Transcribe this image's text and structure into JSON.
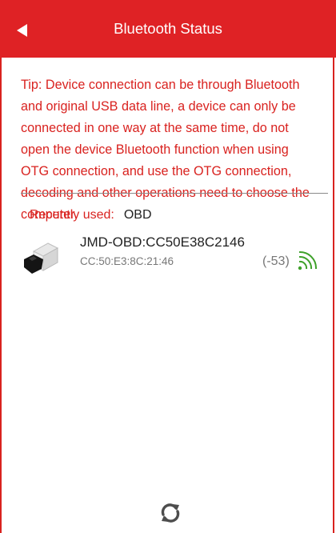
{
  "header": {
    "title": "Bluetooth Status",
    "back_icon": "back-arrow-icon"
  },
  "tip": {
    "text": "Tip: Device connection can be through Bluetooth and original USB data line, a device can only be connected in one way at the same time, do not open the device Bluetooth function when using OTG connection, and use the OTG connection, decoding and other operations need to choose the computer."
  },
  "recent": {
    "label": "Recently used:",
    "value": "OBD"
  },
  "devices": [
    {
      "name": "JMD-OBD:CC50E38C2146",
      "mac": "CC:50:E3:8C:21:46",
      "rssi": "(-53)",
      "icon": "obd-adapter-icon",
      "signal_icon": "signal-strength-icon"
    }
  ],
  "footer": {
    "refresh_icon": "refresh-icon"
  },
  "colors": {
    "header_bg": "#df2225",
    "tip_text": "#d9221f",
    "signal": "#3ea12a"
  }
}
